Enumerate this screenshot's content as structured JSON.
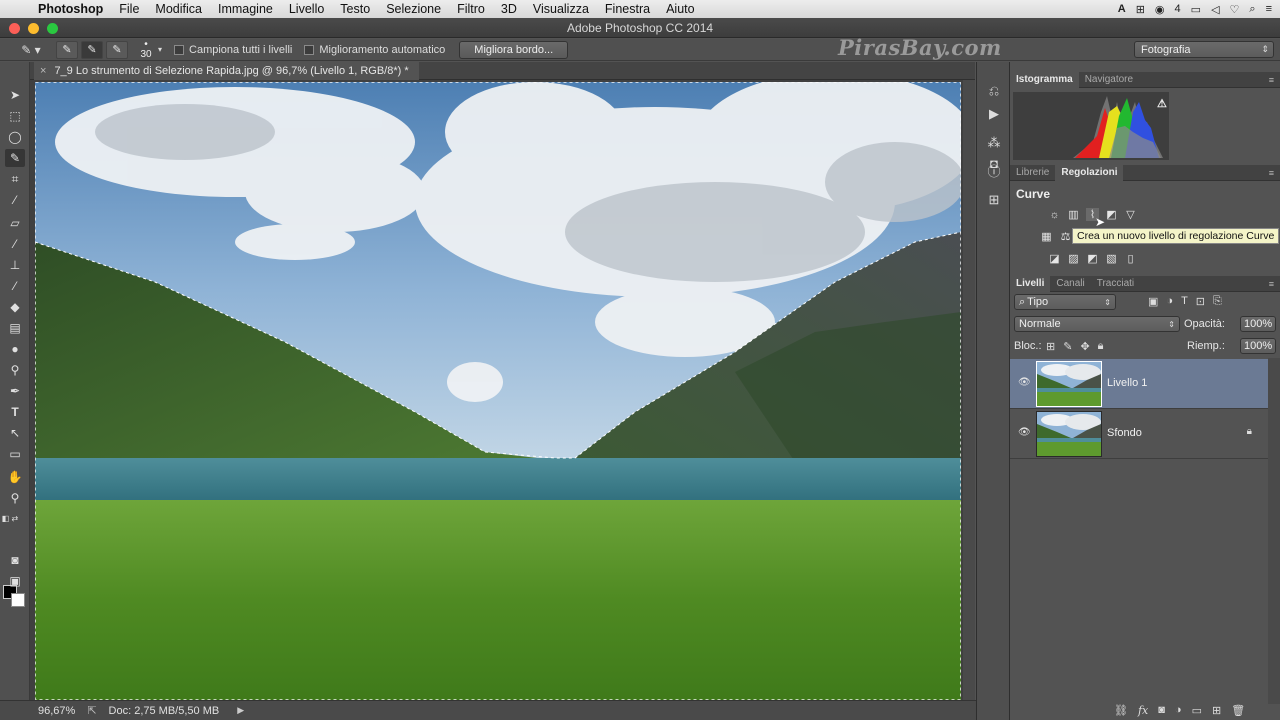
{
  "menubar": {
    "app": "Photoshop",
    "items": [
      "File",
      "Modifica",
      "Immagine",
      "Livello",
      "Testo",
      "Selezione",
      "Filtro",
      "3D",
      "Visualizza",
      "Finestra",
      "Aiuto"
    ],
    "tray": [
      "A",
      "4"
    ]
  },
  "window": {
    "title": "Adobe Photoshop CC 2014"
  },
  "options": {
    "brush_size": "30",
    "sample_all": "Campiona tutti i livelli",
    "auto_enhance": "Miglioramento automatico",
    "refine_edge": "Migliora bordo...",
    "watermark": "PirasBay.com",
    "workspace": "Fotografia"
  },
  "document": {
    "tab_title": "7_9 Lo strumento di Selezione Rapida.jpg @ 96,7% (Livello 1, RGB/8*) *"
  },
  "status": {
    "zoom": "96,67%",
    "doc": "Doc: 2,75 MB/5,50 MB"
  },
  "panels": {
    "top_tabs": [
      "Istogramma",
      "Navigatore"
    ],
    "mid_tabs": [
      "Librerie",
      "Regolazioni"
    ],
    "adjustments_title": "Curve",
    "tooltip": "Crea un nuovo livello di regolazione Curve",
    "layers_tabs": [
      "Livelli",
      "Canali",
      "Tracciati"
    ],
    "filter_kind": "Tipo",
    "blend_mode": "Normale",
    "opacity_label": "Opacità:",
    "opacity_value": "100%",
    "lock_label": "Bloc.:",
    "fill_label": "Riemp.:",
    "fill_value": "100%",
    "layers": [
      {
        "name": "Livello 1",
        "selected": true,
        "locked": false
      },
      {
        "name": "Sfondo",
        "selected": false,
        "locked": true
      }
    ]
  },
  "colors": {
    "selected_layer": "#6b7a94",
    "panel_bg": "#535353",
    "tooltip_bg": "#f4f4c8"
  }
}
